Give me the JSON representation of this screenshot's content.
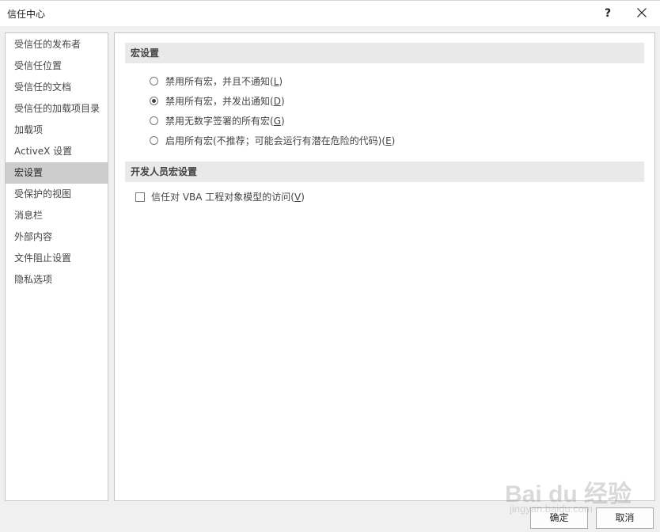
{
  "window": {
    "title": "信任中心",
    "help_label": "?"
  },
  "sidebar": {
    "selected_index": 6,
    "items": [
      {
        "label": "受信任的发布者"
      },
      {
        "label": "受信任位置"
      },
      {
        "label": "受信任的文档"
      },
      {
        "label": "受信任的加载项目录"
      },
      {
        "label": "加载项"
      },
      {
        "label": "ActiveX 设置"
      },
      {
        "label": "宏设置"
      },
      {
        "label": "受保护的视图"
      },
      {
        "label": "消息栏"
      },
      {
        "label": "外部内容"
      },
      {
        "label": "文件阻止设置"
      },
      {
        "label": "隐私选项"
      }
    ]
  },
  "macro_settings": {
    "header": "宏设置",
    "options": [
      {
        "text": "禁用所有宏，并且不通知(",
        "key": "L",
        "suffix": ")",
        "selected": false
      },
      {
        "text": "禁用所有宏，并发出通知(",
        "key": "D",
        "suffix": ")",
        "selected": true
      },
      {
        "text": "禁用无数字签署的所有宏(",
        "key": "G",
        "suffix": ")",
        "selected": false
      },
      {
        "text": "启用所有宏(不推荐；可能会运行有潜在危险的代码)(",
        "key": "E",
        "suffix": ")",
        "selected": false
      }
    ]
  },
  "developer_settings": {
    "header": "开发人员宏设置",
    "checkbox": {
      "text": "信任对 VBA 工程对象模型的访问(",
      "key": "V",
      "suffix": ")",
      "checked": false
    }
  },
  "buttons": {
    "ok": "确定",
    "cancel": "取消"
  },
  "watermark": {
    "logo": "Bai du 经验",
    "url": "jingyan.baidu.com"
  }
}
